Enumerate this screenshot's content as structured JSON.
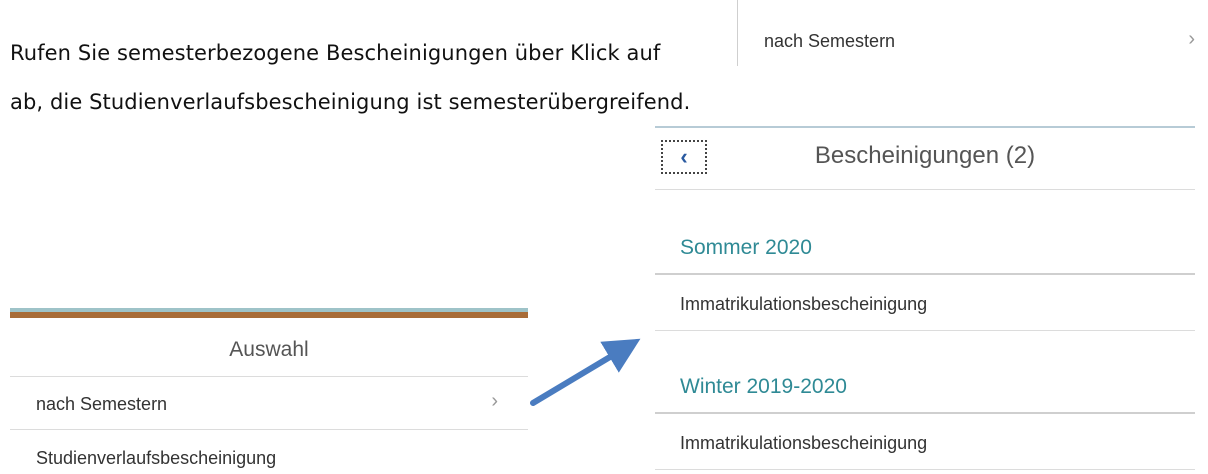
{
  "doc": {
    "line1": "Rufen Sie semesterbezogene Bescheinigungen über Klick auf",
    "line2": "ab, die Studienverlaufsbescheinigung ist semesterübergreifend."
  },
  "snippet": {
    "label": "nach Semestern",
    "chevron": "›"
  },
  "left_panel": {
    "title": "Auswahl",
    "items": [
      {
        "label": "nach Semestern",
        "chevron": "›"
      },
      {
        "label": "Studienverlaufsbescheinigung"
      }
    ]
  },
  "right_panel": {
    "back_icon": "‹",
    "title": "Bescheinigungen (2)",
    "groups": [
      {
        "name": "Sommer 2020",
        "items": [
          "Immatrikulationsbescheinigung"
        ]
      },
      {
        "name": "Winter 2019-2020",
        "items": [
          "Immatrikulationsbescheinigung"
        ]
      }
    ]
  },
  "colors": {
    "group_heading": "#2f8a95",
    "arrow": "#4a7cc0",
    "accent_bar_top": "#9ec3c8",
    "accent_bar_bottom": "#a86c38"
  }
}
